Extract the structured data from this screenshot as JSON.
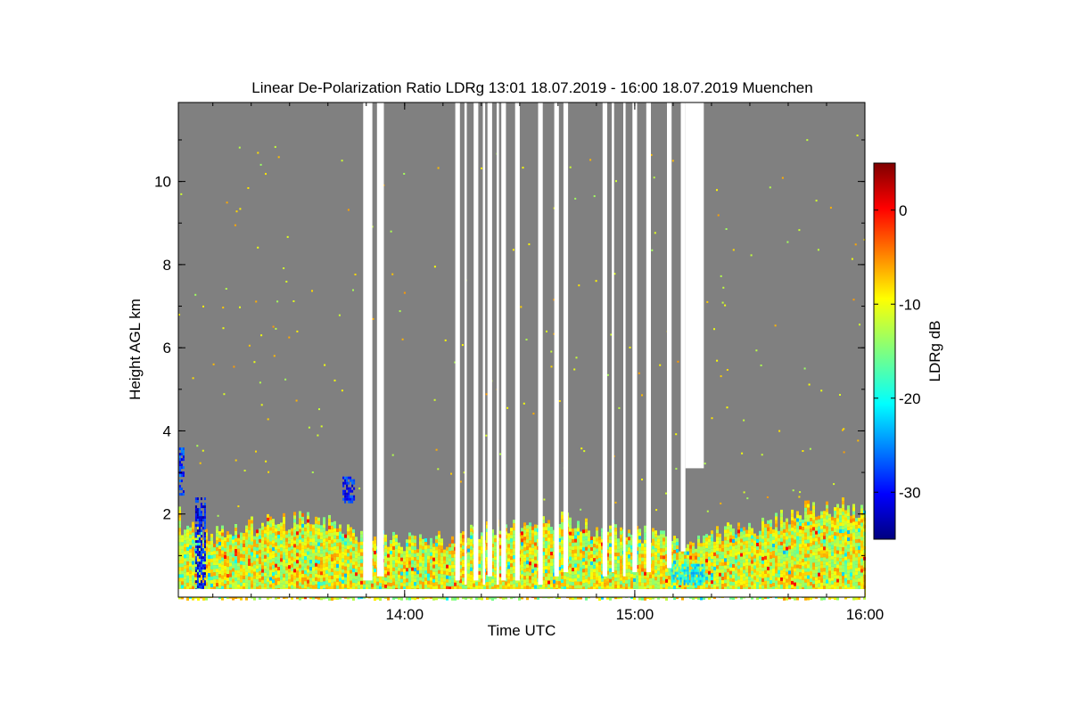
{
  "chart_data": {
    "type": "heatmap",
    "title": "Linear De-Polarization Ratio LDRg   13:01 18.07.2019 - 16:00 18.07.2019 Muenchen",
    "xlabel": "Time UTC",
    "ylabel": "Height AGL km",
    "colorbar_label": "LDRg dB",
    "x_range": [
      "13:01",
      "16:00"
    ],
    "xlim_hours": [
      13.0167,
      16.0
    ],
    "ylim_km": [
      0.0,
      11.9
    ],
    "x_ticks": [
      {
        "label": "14:00",
        "value": 14.0
      },
      {
        "label": "15:00",
        "value": 15.0
      },
      {
        "label": "16:00",
        "value": 16.0
      }
    ],
    "y_ticks": [
      {
        "label": "2",
        "value": 2
      },
      {
        "label": "4",
        "value": 4
      },
      {
        "label": "6",
        "value": 6
      },
      {
        "label": "8",
        "value": 8
      },
      {
        "label": "10",
        "value": 10
      }
    ],
    "colorbar_range_db": [
      -35,
      5
    ],
    "colorbar_ticks": [
      {
        "label": "0",
        "value": 0
      },
      {
        "label": "-10",
        "value": -10
      },
      {
        "label": "-20",
        "value": -20
      },
      {
        "label": "-30",
        "value": -30
      }
    ],
    "background_color": "#808080",
    "no_data_color": "#ffffff",
    "colormap": "jet",
    "boundary_layer_top_km": [
      {
        "t": 13.02,
        "h": 1.6
      },
      {
        "t": 13.2,
        "h": 1.5
      },
      {
        "t": 13.4,
        "h": 1.8
      },
      {
        "t": 13.6,
        "h": 1.9
      },
      {
        "t": 13.8,
        "h": 1.5
      },
      {
        "t": 14.0,
        "h": 1.3
      },
      {
        "t": 14.2,
        "h": 1.4
      },
      {
        "t": 14.4,
        "h": 1.7
      },
      {
        "t": 14.6,
        "h": 1.9
      },
      {
        "t": 14.8,
        "h": 1.7
      },
      {
        "t": 15.0,
        "h": 1.6
      },
      {
        "t": 15.2,
        "h": 1.2
      },
      {
        "t": 15.4,
        "h": 1.6
      },
      {
        "t": 15.6,
        "h": 1.8
      },
      {
        "t": 15.8,
        "h": 2.2
      },
      {
        "t": 16.0,
        "h": 2.1
      }
    ],
    "low_ldr_features": [
      {
        "t_start": 13.02,
        "t_end": 13.04,
        "h_bottom": 2.5,
        "h_top": 3.6,
        "ldr_db": -28
      },
      {
        "t_start": 13.09,
        "t_end": 13.13,
        "h_bottom": 0.2,
        "h_top": 2.4,
        "ldr_db": -30
      },
      {
        "t_start": 13.73,
        "t_end": 13.78,
        "h_bottom": 2.3,
        "h_top": 2.9,
        "ldr_db": -29
      },
      {
        "t_start": 15.15,
        "t_end": 15.3,
        "h_bottom": 0.3,
        "h_top": 0.8,
        "ldr_db": -20
      }
    ],
    "no_data_gaps_hours": [
      {
        "t_start": 13.82,
        "t_end": 13.86,
        "h_bottom": 0.4
      },
      {
        "t_start": 13.88,
        "t_end": 13.91,
        "h_bottom": 0.5
      },
      {
        "t_start": 14.22,
        "t_end": 14.24,
        "h_bottom": 0.4
      },
      {
        "t_start": 14.26,
        "t_end": 14.27,
        "h_bottom": 0.3
      },
      {
        "t_start": 14.3,
        "t_end": 14.32,
        "h_bottom": 0.4
      },
      {
        "t_start": 14.34,
        "t_end": 14.35,
        "h_bottom": 0.3
      },
      {
        "t_start": 14.36,
        "t_end": 14.38,
        "h_bottom": 0.5
      },
      {
        "t_start": 14.4,
        "t_end": 14.41,
        "h_bottom": 0.3
      },
      {
        "t_start": 14.42,
        "t_end": 14.44,
        "h_bottom": 0.4
      },
      {
        "t_start": 14.48,
        "t_end": 14.5,
        "h_bottom": 0.4
      },
      {
        "t_start": 14.58,
        "t_end": 14.6,
        "h_bottom": 0.3
      },
      {
        "t_start": 14.65,
        "t_end": 14.67,
        "h_bottom": 0.5
      },
      {
        "t_start": 14.69,
        "t_end": 14.71,
        "h_bottom": 0.6
      },
      {
        "t_start": 14.86,
        "t_end": 14.88,
        "h_bottom": 0.5
      },
      {
        "t_start": 14.9,
        "t_end": 14.91,
        "h_bottom": 0.6
      },
      {
        "t_start": 14.95,
        "t_end": 14.96,
        "h_bottom": 0.5
      },
      {
        "t_start": 14.99,
        "t_end": 15.01,
        "h_bottom": 0.6
      },
      {
        "t_start": 15.05,
        "t_end": 15.07,
        "h_bottom": 0.6
      },
      {
        "t_start": 15.14,
        "t_end": 15.16,
        "h_bottom": 0.7
      },
      {
        "t_start": 15.2,
        "t_end": 15.22,
        "h_bottom": 1.1
      },
      {
        "t_start": 15.22,
        "t_end": 15.3,
        "h_bottom": 3.1
      }
    ]
  }
}
